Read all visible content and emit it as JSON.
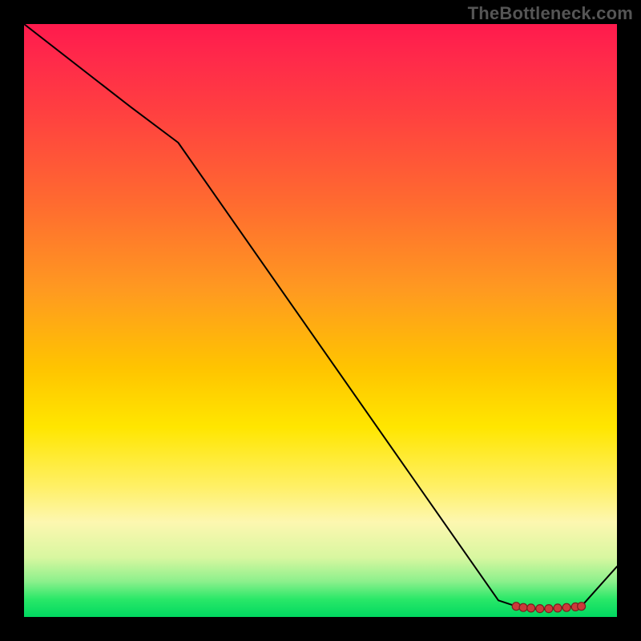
{
  "attribution": "TheBottleneck.com",
  "chart_data": {
    "type": "line",
    "title": "",
    "xlabel": "",
    "ylabel": "",
    "x": [
      0.0,
      0.18,
      0.26,
      0.8,
      0.83,
      0.84,
      0.86,
      0.87,
      0.89,
      0.9,
      0.92,
      0.94,
      1.0
    ],
    "values": [
      1.0,
      0.86,
      0.8,
      0.028,
      0.018,
      0.016,
      0.014,
      0.013,
      0.014,
      0.015,
      0.017,
      0.018,
      0.085
    ],
    "xlim": [
      0,
      1
    ],
    "ylim": [
      0,
      1
    ],
    "markers_x": [
      0.83,
      0.842,
      0.855,
      0.87,
      0.885,
      0.9,
      0.915,
      0.93,
      0.94
    ],
    "markers_y": [
      0.018,
      0.016,
      0.015,
      0.014,
      0.014,
      0.015,
      0.016,
      0.017,
      0.018
    ],
    "gradient_note": "background is a vertical colour gradient from red (top) through orange/yellow to green (bottom)"
  }
}
